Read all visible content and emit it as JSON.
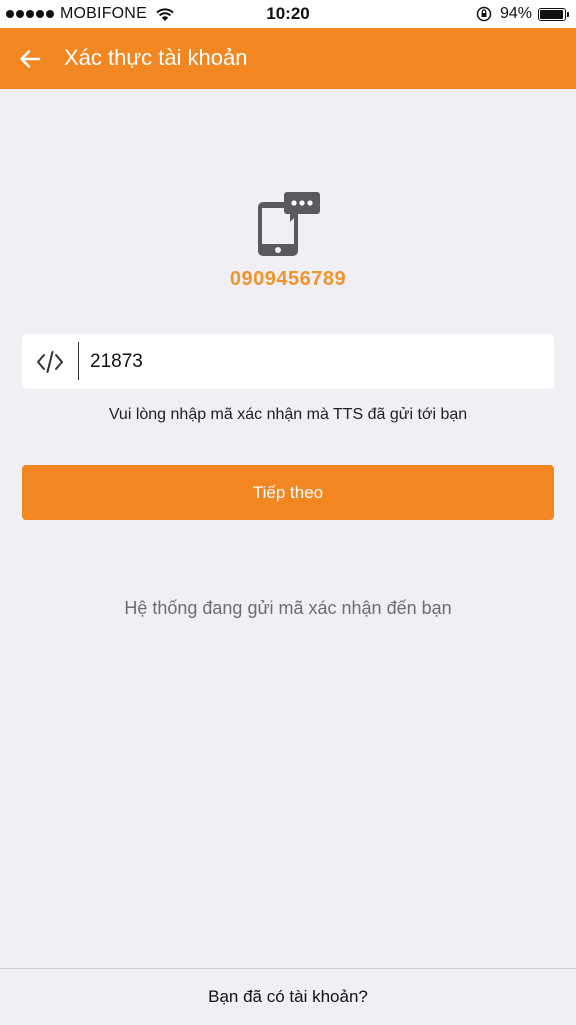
{
  "status_bar": {
    "carrier": "MOBIFONE",
    "time": "10:20",
    "battery_percent": "94%",
    "battery_level": 0.94,
    "signal_icon": "signal-dots-icon",
    "wifi_icon": "wifi-icon",
    "rotation_lock_icon": "rotation-lock-icon"
  },
  "nav": {
    "back_icon": "arrow-left-icon",
    "title": "Xác thực tài khoản"
  },
  "verification": {
    "icon": "phone-sms-icon",
    "phone_number": "0909456789",
    "code_icon": "code-icon",
    "code_value": "21873",
    "hint": "Vui lòng nhập mã xác nhận mà TTS đã gửi tới bạn",
    "next_button_label": "Tiếp theo",
    "sending_status": "Hệ thống đang gửi mã xác nhận đến bạn"
  },
  "footer": {
    "login_link": "Bạn đã có tài khoản?"
  },
  "colors": {
    "accent": "#f28722",
    "phone_number": "#f0952e",
    "background": "#efeff4",
    "muted_text": "#6d6d72"
  }
}
